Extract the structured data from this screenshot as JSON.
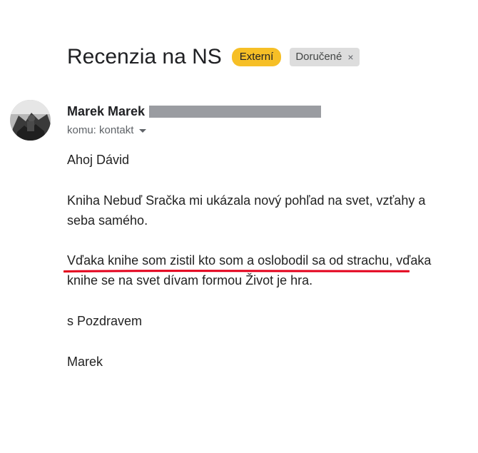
{
  "email": {
    "subject": "Recenzia na NS",
    "labels": {
      "external": "Externí",
      "inbox": "Doručené",
      "inbox_remove": "×"
    },
    "sender": {
      "name": "Marek Marek"
    },
    "recipient": "komu: kontakt",
    "body": {
      "greeting": "Ahoj Dávid",
      "para1_line1": "Kniha Nebuď Sračka mi ukázala nový pohľad na svet, vzťahy a",
      "para1_line2": "seba samého.",
      "para2_line1": "Vďaka knihe som zistil kto som a oslobodil sa od strachu, vďaka",
      "para2_line2": "knihe se na svet dívam formou Život je hra.",
      "closing": "s Pozdravem",
      "signature": "Marek"
    }
  },
  "colors": {
    "external_label": "#f6bf26",
    "inbox_label": "#dddddd",
    "redaction": "#9a9ca1",
    "underline_annotation": "#e3001b"
  },
  "icons": {
    "avatar": "avatar-photo",
    "recipient_toggle": "caret-down-icon"
  }
}
